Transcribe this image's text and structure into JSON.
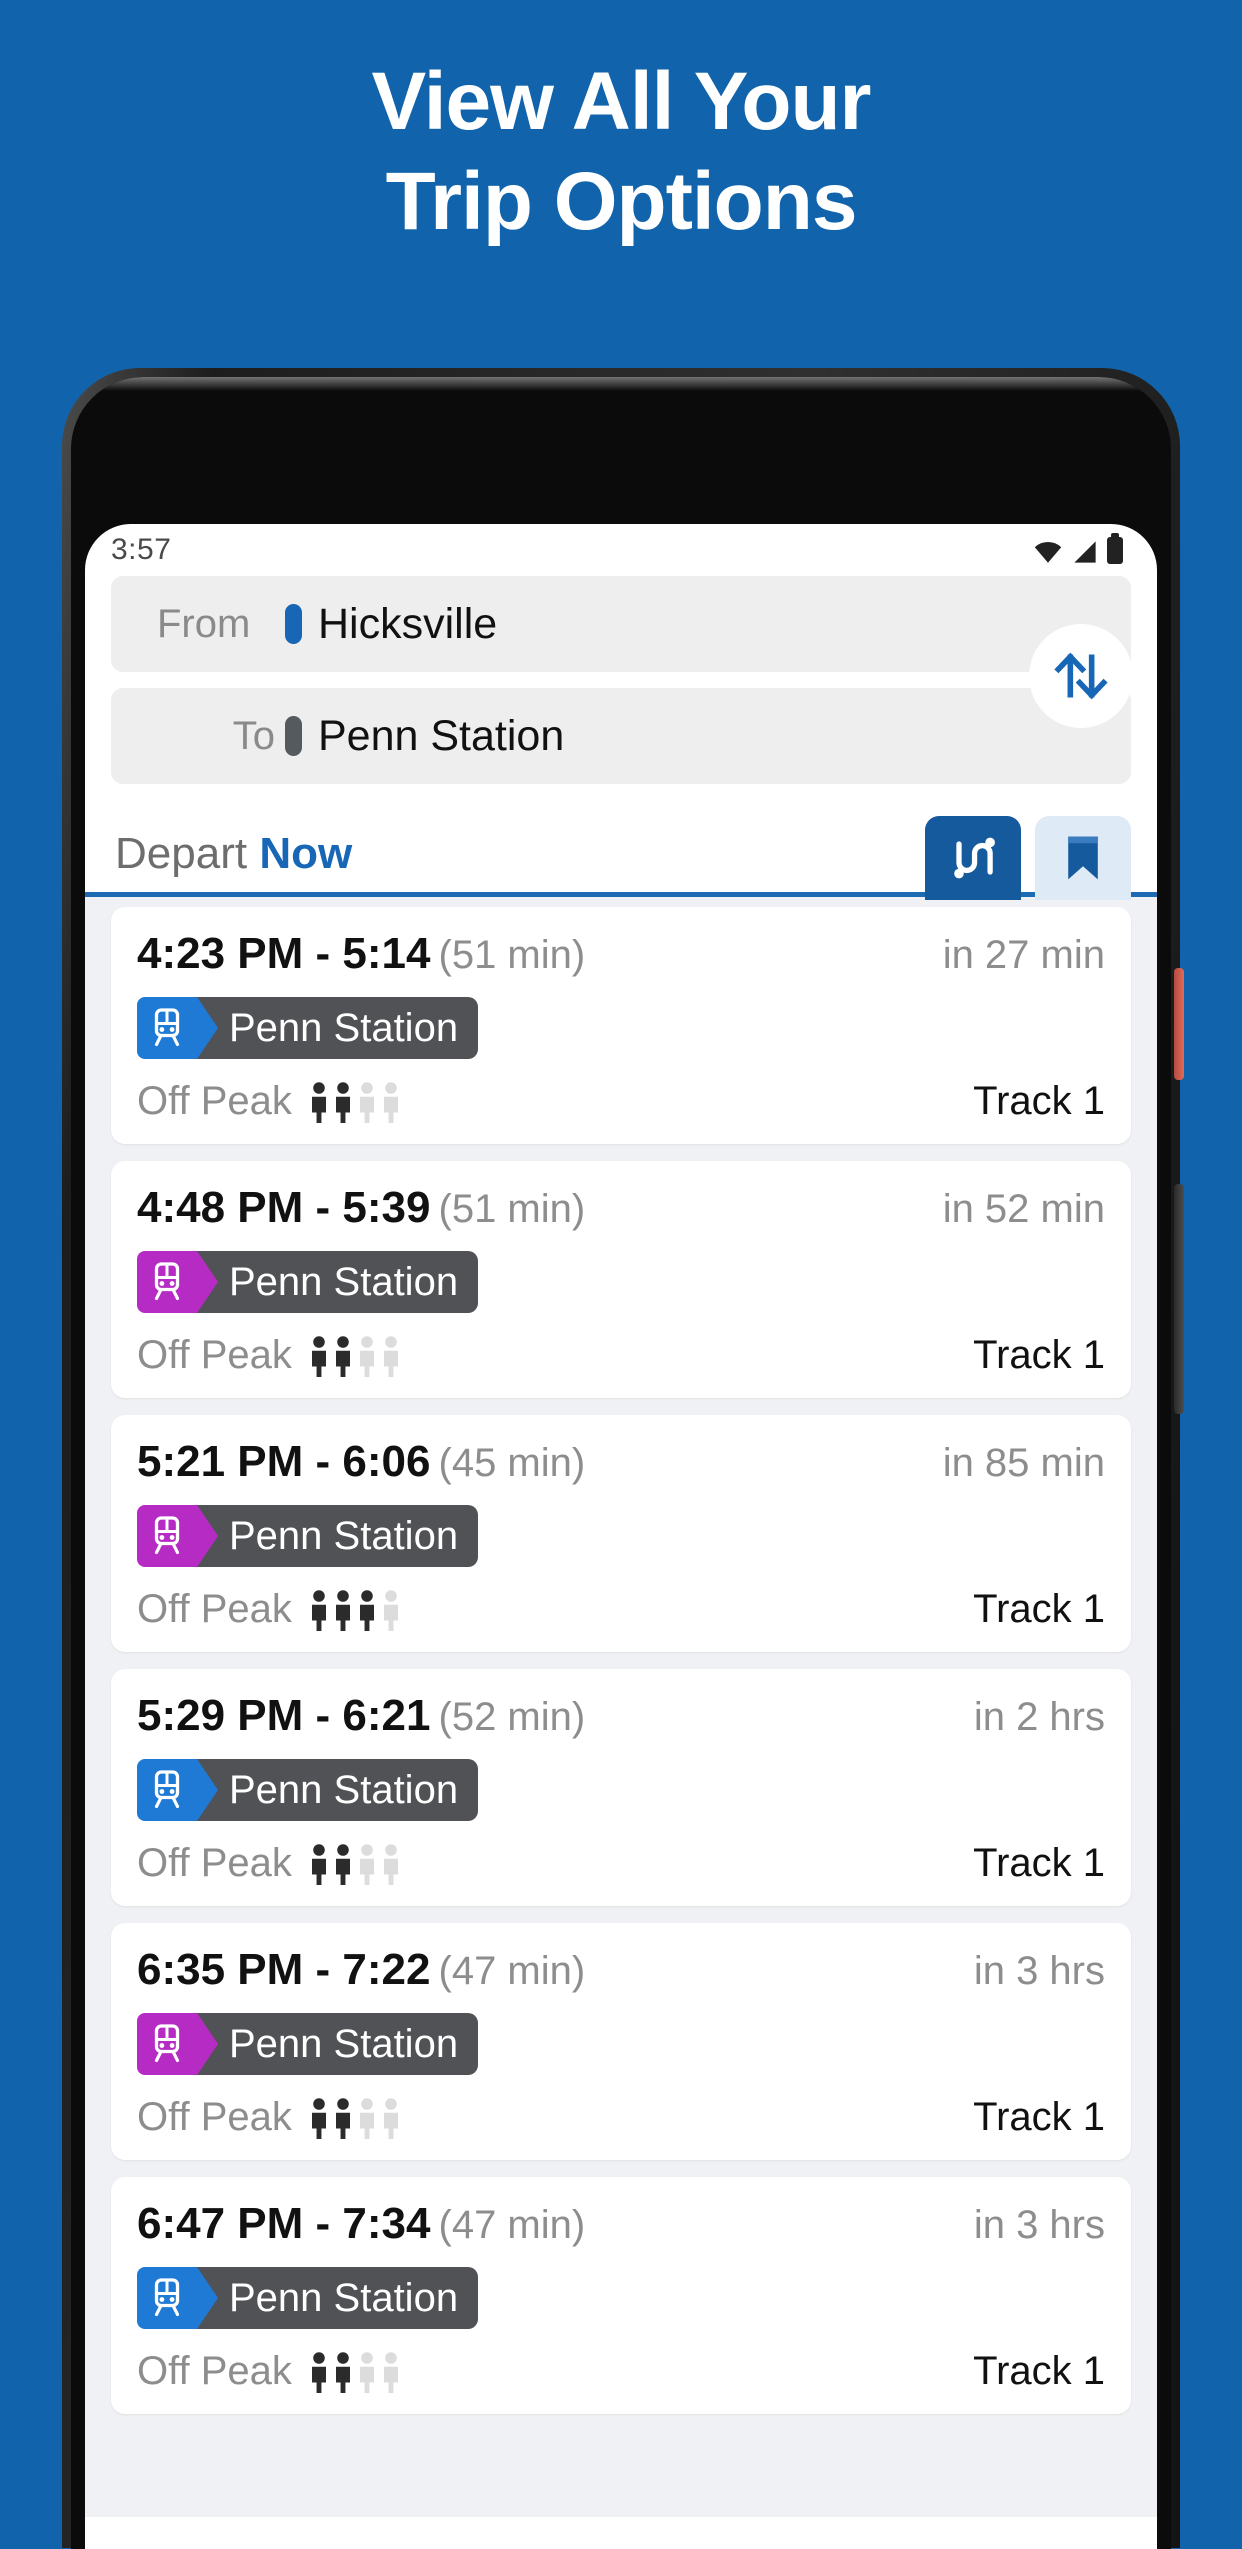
{
  "headline": {
    "line1": "View All Your",
    "line2": "Trip Options"
  },
  "colors": {
    "background": "#1164ab",
    "accent_blue": "#1867b6",
    "badge_blue": "#1e7ad4",
    "badge_purple": "#b62bc4",
    "badge_name_bg": "#515255",
    "rule_blue": "#1d6bb3"
  },
  "status_bar": {
    "time": "3:57",
    "icons": [
      "wifi-icon",
      "signal-icon",
      "battery-icon"
    ]
  },
  "search": {
    "from": {
      "label": "From",
      "value": "Hicksville",
      "marker": "origin-pill",
      "marker_color": "#1867b6"
    },
    "to": {
      "label": "To",
      "value": "Penn Station",
      "marker": "destination-pill",
      "marker_color": "#555a5e"
    },
    "swap_icon": "swap-vertical-icon"
  },
  "depart": {
    "label": "Depart",
    "value": "Now",
    "actions": [
      {
        "name": "trip-route-button",
        "icon": "route-map-icon",
        "style": "primary"
      },
      {
        "name": "saved-trips-button",
        "icon": "bookmark-icon",
        "style": "ghost"
      }
    ]
  },
  "results": [
    {
      "depart": "4:23 PM",
      "dash": "-",
      "arrive": "5:14",
      "duration": "(51 min)",
      "eta": "in 27 min",
      "destination": "Penn Station",
      "line_color": "#1e7ad4",
      "fare": "Off Peak",
      "occupancy": 2,
      "occupancy_total": 4,
      "track": "Track 1"
    },
    {
      "depart": "4:48 PM",
      "dash": "-",
      "arrive": "5:39",
      "duration": "(51 min)",
      "eta": "in 52 min",
      "destination": "Penn Station",
      "line_color": "#b62bc4",
      "fare": "Off Peak",
      "occupancy": 2,
      "occupancy_total": 4,
      "track": "Track 1"
    },
    {
      "depart": "5:21 PM",
      "dash": "-",
      "arrive": "6:06",
      "duration": "(45 min)",
      "eta": "in 85 min",
      "destination": "Penn Station",
      "line_color": "#b62bc4",
      "fare": "Off Peak",
      "occupancy": 3,
      "occupancy_total": 4,
      "track": "Track 1"
    },
    {
      "depart": "5:29 PM",
      "dash": "-",
      "arrive": "6:21",
      "duration": "(52 min)",
      "eta": "in 2 hrs",
      "destination": "Penn Station",
      "line_color": "#1e7ad4",
      "fare": "Off Peak",
      "occupancy": 2,
      "occupancy_total": 4,
      "track": "Track 1"
    },
    {
      "depart": "6:35 PM",
      "dash": "-",
      "arrive": "7:22",
      "duration": "(47 min)",
      "eta": "in 3 hrs",
      "destination": "Penn Station",
      "line_color": "#b62bc4",
      "fare": "Off Peak",
      "occupancy": 2,
      "occupancy_total": 4,
      "track": "Track 1"
    },
    {
      "depart": "6:47 PM",
      "dash": "-",
      "arrive": "7:34",
      "duration": "(47 min)",
      "eta": "in 3 hrs",
      "destination": "Penn Station",
      "line_color": "#1e7ad4",
      "fare": "Off Peak",
      "occupancy": 2,
      "occupancy_total": 4,
      "track": "Track 1"
    }
  ]
}
